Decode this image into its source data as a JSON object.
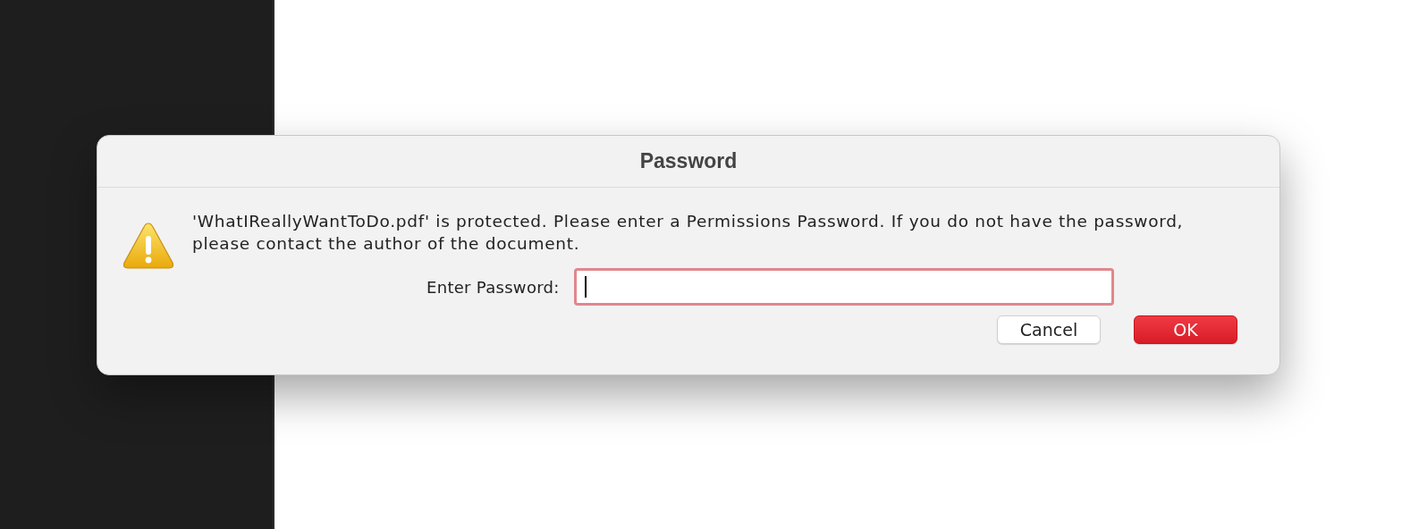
{
  "dialog": {
    "title": "Password",
    "message": "'WhatIReallyWantToDo.pdf' is protected. Please enter a Permissions Password. If you do not have the password, please contact the author of the document.",
    "field": {
      "label": "Enter Password:",
      "focused": true
    },
    "buttons": [
      {
        "label": "Cancel",
        "kind": "secondary"
      },
      {
        "label": "OK",
        "kind": "default"
      }
    ]
  }
}
